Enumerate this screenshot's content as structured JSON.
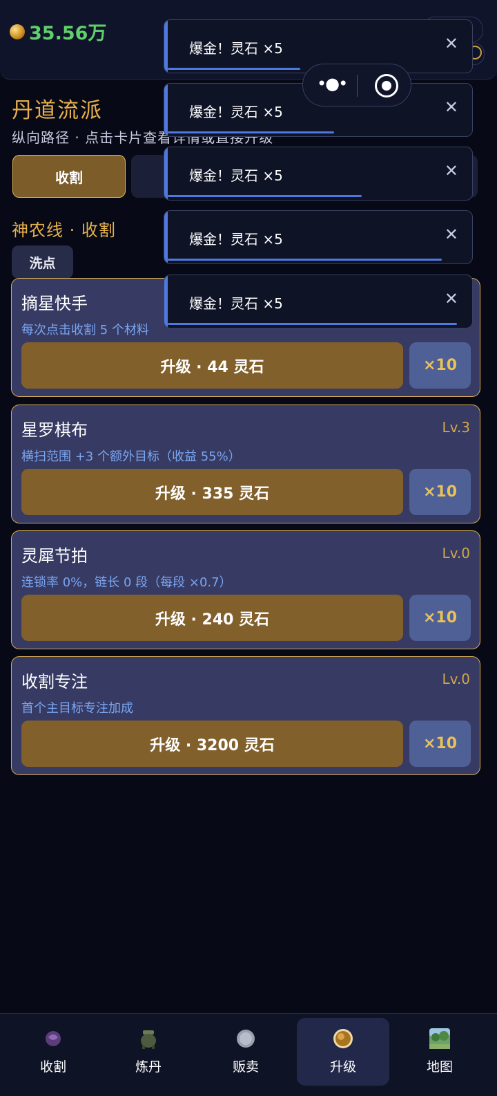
{
  "header": {
    "balance": "35.56万"
  },
  "section": {
    "title": "丹道流派",
    "subtitle": "纵向路径 · 点击卡片查看详情或直接升级"
  },
  "tabs": [
    {
      "label": "收割",
      "active": true
    }
  ],
  "path": {
    "title": "神农线 · 收割",
    "reset_label": "洗点"
  },
  "cards": [
    {
      "name": "摘星快手",
      "level": "",
      "desc": "每次点击收割 5 个材料",
      "upgrade_label": "升级 · 44 灵石",
      "multi_label": "×10"
    },
    {
      "name": "星罗棋布",
      "level": "Lv.3",
      "desc": "横扫范围 +3 个额外目标（收益 55%）",
      "upgrade_label": "升级 · 335 灵石",
      "multi_label": "×10"
    },
    {
      "name": "灵犀节拍",
      "level": "Lv.0",
      "desc": "连锁率 0%，链长 0 段（每段 ×0.7）",
      "upgrade_label": "升级 · 240 灵石",
      "multi_label": "×10"
    },
    {
      "name": "收割专注",
      "level": "Lv.0",
      "desc": "首个主目标专注加成",
      "upgrade_label": "升级 · 3200 灵石",
      "multi_label": "×10"
    }
  ],
  "toasts": [
    {
      "text": "爆金！灵石 ×5",
      "close": "✕",
      "progress": 0.43
    },
    {
      "text": "爆金！灵石 ×5",
      "close": "✕",
      "progress": 0.54
    },
    {
      "text": "爆金！灵石 ×5",
      "close": "✕",
      "progress": 0.63
    },
    {
      "text": "爆金！灵石 ×5",
      "close": "✕",
      "progress": 0.89
    },
    {
      "text": "爆金！灵石 ×5",
      "close": "✕",
      "progress": 0.94
    }
  ],
  "nav": [
    {
      "label": "收割",
      "icon": "harvest-icon",
      "active": false
    },
    {
      "label": "炼丹",
      "icon": "cauldron-icon",
      "active": false
    },
    {
      "label": "贩卖",
      "icon": "sell-icon",
      "active": false
    },
    {
      "label": "升级",
      "icon": "upgrade-icon",
      "active": true
    },
    {
      "label": "地图",
      "icon": "map-icon",
      "active": false
    }
  ],
  "colors": {
    "accent_gold": "#e8b04a",
    "balance_green": "#5fd06b",
    "toast_blue": "#4f79e0",
    "card_bg": "#373b63"
  }
}
